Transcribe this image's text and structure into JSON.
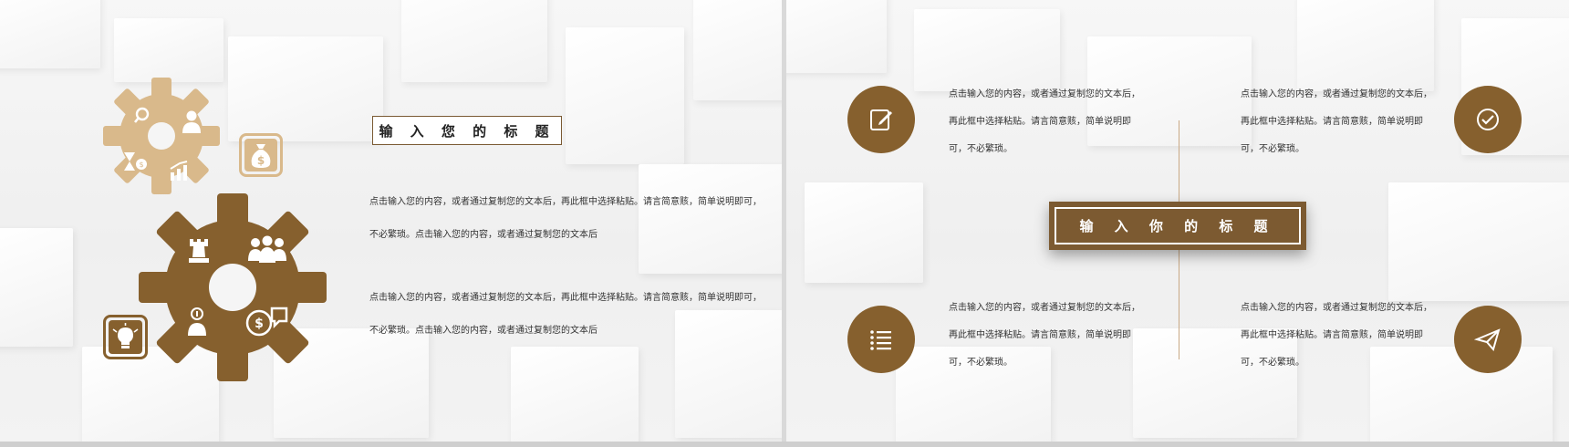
{
  "colors": {
    "gold": "#d9b98b",
    "brown": "#86602e",
    "dark_brown": "#7c5a31",
    "text": "#333333"
  },
  "left_slide": {
    "title": "输 入 您 的 标 题",
    "paragraphs": [
      {
        "line1": "点击输入您的内容，或者通过复制您的文本后，再此框中选择粘贴。请言简意赅，简单说明即可，",
        "line2": "不必繁琐。点击输入您的内容，或者通过复制您的文本后"
      },
      {
        "line1": "点击输入您的内容，或者通过复制您的文本后，再此框中选择粘贴。请言简意赅，简单说明即可，",
        "line2": "不必繁琐。点击输入您的内容，或者通过复制您的文本后"
      }
    ],
    "icons": [
      "search-icon",
      "user-icon",
      "hourglass-icon",
      "coin-icon",
      "growth-chart-icon",
      "money-bag-icon",
      "chess-rook-icon",
      "team-icon",
      "idea-person-icon",
      "money-chat-icon",
      "lightbulb-icon"
    ]
  },
  "right_slide": {
    "title": "输 入 你 的 标 题",
    "blocks": [
      {
        "line1": "点击输入您的内容，或者通过复制您的文本后，",
        "line2": "再此框中选择粘贴。请言简意赅，简单说明即",
        "line3": "可，不必繁琐。",
        "icon": "edit-icon"
      },
      {
        "line1": "点击输入您的内容，或者通过复制您的文本后，",
        "line2": "再此框中选择粘贴。请言简意赅，简单说明即",
        "line3": "可，不必繁琐。",
        "icon": "check-icon"
      },
      {
        "line1": "点击输入您的内容，或者通过复制您的文本后，",
        "line2": "再此框中选择粘贴。请言简意赅，简单说明即",
        "line3": "可，不必繁琐。",
        "icon": "list-icon"
      },
      {
        "line1": "点击输入您的内容，或者通过复制您的文本后，",
        "line2": "再此框中选择粘贴。请言简意赅，简单说明即",
        "line3": "可，不必繁琐。",
        "icon": "send-icon"
      }
    ]
  }
}
